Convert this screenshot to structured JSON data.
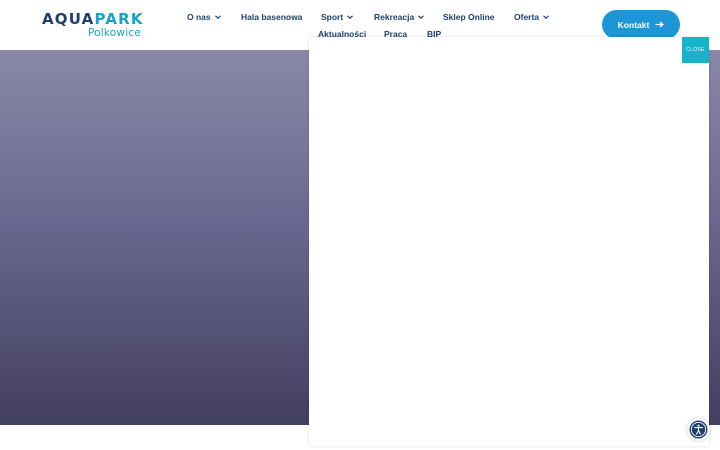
{
  "logo": {
    "main_prefix": "AQUA",
    "main_suffix": "PARK",
    "sub": "Polkowice"
  },
  "nav": {
    "items": [
      {
        "label": "O nas",
        "has_dropdown": true
      },
      {
        "label": "Hala basenowa",
        "has_dropdown": false
      },
      {
        "label": "Sport",
        "has_dropdown": true
      },
      {
        "label": "Rekreacja",
        "has_dropdown": true
      },
      {
        "label": "Sklep Online",
        "has_dropdown": false
      },
      {
        "label": "Oferta",
        "has_dropdown": true
      },
      {
        "label": "Aktualności",
        "has_dropdown": false
      },
      {
        "label": "Praca",
        "has_dropdown": false
      },
      {
        "label": "BIP",
        "has_dropdown": false
      }
    ]
  },
  "contact_button": {
    "label": "Kontakt"
  },
  "modal": {
    "close_label": "CLOSE"
  },
  "icons": {
    "chevron": "chevron-down-icon",
    "arrow": "arrow-right-icon",
    "accessibility": "accessibility-icon"
  },
  "colors": {
    "brand_dark": "#1d3f6e",
    "brand_light": "#17a3c7",
    "button": "#1d95d6",
    "close": "#17b3c9"
  }
}
